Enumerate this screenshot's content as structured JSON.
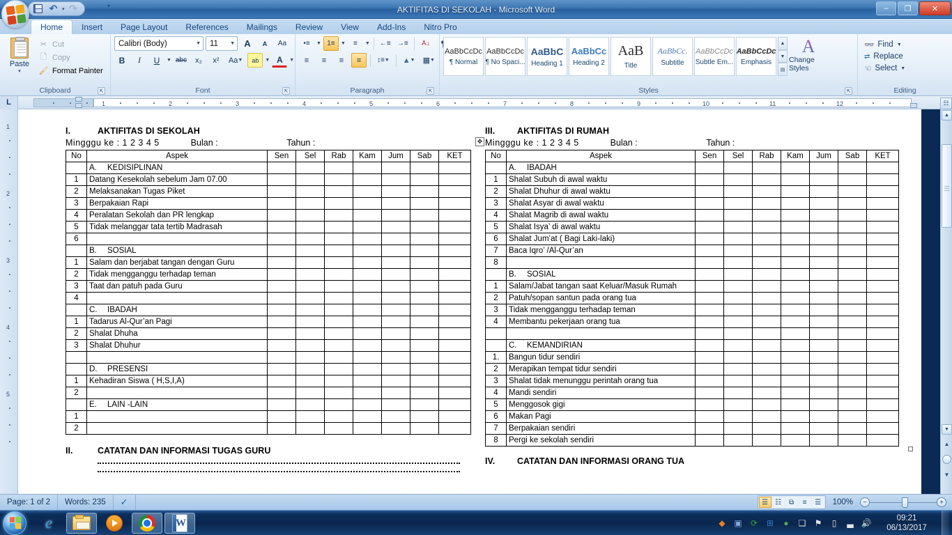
{
  "window": {
    "title": "AKTIFITAS DI SEKOLAH  -  Microsoft Word",
    "minimize_label": "–",
    "maximize_label": "❐",
    "close_label": "✕"
  },
  "quick_access": {
    "save_tooltip": "Save",
    "undo_glyph": "↶",
    "redo_glyph": "↷",
    "dropdown_glyph": "▾"
  },
  "ribbon": {
    "tabs": [
      {
        "label": "Home",
        "active": true
      },
      {
        "label": "Insert",
        "active": false
      },
      {
        "label": "Page Layout",
        "active": false
      },
      {
        "label": "References",
        "active": false
      },
      {
        "label": "Mailings",
        "active": false
      },
      {
        "label": "Review",
        "active": false
      },
      {
        "label": "View",
        "active": false
      },
      {
        "label": "Add-Ins",
        "active": false
      },
      {
        "label": "Nitro Pro",
        "active": false
      }
    ],
    "clipboard": {
      "label": "Clipboard",
      "paste": "Paste",
      "cut": "Cut",
      "copy": "Copy",
      "format_painter": "Format Painter",
      "cut_icon": "scissors-icon",
      "copy_icon": "copy-icon",
      "format_painter_icon": "paintbrush-icon"
    },
    "font": {
      "label": "Font",
      "font_name": "Calibri (Body)",
      "font_size": "11",
      "grow_font": "A",
      "shrink_font": "A",
      "clear_formatting": "Aa",
      "bold": "B",
      "italic": "I",
      "underline": "U",
      "strikethrough": "abc",
      "subscript": "x₂",
      "superscript": "x²",
      "change_case": "Aa",
      "highlight": "ab",
      "font_color": "A"
    },
    "paragraph": {
      "label": "Paragraph",
      "bullets": "•≡",
      "numbering": "1≡",
      "multilevel": "≡",
      "decrease_indent": "←≡",
      "increase_indent": "→≡",
      "sort": "A↓",
      "show_marks": "¶",
      "align_left": "≡",
      "align_center": "≡",
      "align_right": "≡",
      "justify": "≡",
      "line_spacing": "↕≡",
      "shading": "▲",
      "borders": "▦"
    },
    "styles": {
      "label": "Styles",
      "items": [
        {
          "sample": "AaBbCcDc",
          "name": "¶ Normal"
        },
        {
          "sample": "AaBbCcDc",
          "name": "¶ No Spaci..."
        },
        {
          "sample": "AaBbC",
          "name": "Heading 1"
        },
        {
          "sample": "AaBbCc",
          "name": "Heading 2"
        },
        {
          "sample": "AaB",
          "name": "Title"
        },
        {
          "sample": "AaBbCc.",
          "name": "Subtitle"
        },
        {
          "sample": "AaBbCcDc",
          "name": "Subtle Em..."
        },
        {
          "sample": "AaBbCcDc",
          "name": "Emphasis"
        }
      ],
      "change_styles": "Change Styles"
    },
    "editing": {
      "label": "Editing",
      "find": "Find",
      "replace": "Replace",
      "select": "Select",
      "find_icon": "binoculars-icon",
      "replace_icon": "replace-icon",
      "select_icon": "cursor-select-icon"
    }
  },
  "ruler": {
    "tab_selector": "L",
    "h_ticks": [
      "1",
      "2",
      "3",
      "4",
      "5",
      "6",
      "7",
      "8",
      "9",
      "10",
      "11",
      "12"
    ],
    "v_ticks": [
      "1",
      "2",
      "3",
      "4",
      "5"
    ]
  },
  "document": {
    "table_handle_glyph": "✥",
    "columns": [
      "No",
      "Aspek",
      "Sen",
      "Sel",
      "Rab",
      "Kam",
      "Jum",
      "Sab",
      "KET"
    ],
    "left": {
      "section_number": "I.",
      "section_title": "AKTIFITAS DI SEKOLAH",
      "week_label": "Mingggu ke : 1   2  3  4   5",
      "month_label": "Bulan :",
      "year_label": "Tahun :",
      "rows": [
        {
          "no": "",
          "aspek": "KEDISIPLINAN",
          "letter": "A.",
          "group": true
        },
        {
          "no": "1",
          "aspek": "Datang Kesekolah sebelum Jam 07.00",
          "group": false
        },
        {
          "no": "2",
          "aspek": "Melaksanakan Tugas Piket",
          "group": false
        },
        {
          "no": "3",
          "aspek": "Berpakaian Rapi",
          "group": false
        },
        {
          "no": "4",
          "aspek": "Peralatan Sekolah dan PR lengkap",
          "group": false
        },
        {
          "no": "5",
          "aspek": "Tidak melanggar tata tertib Madrasah",
          "group": false
        },
        {
          "no": "6",
          "aspek": "",
          "group": false
        },
        {
          "no": "",
          "aspek": "SOSIAL",
          "letter": "B.",
          "group": true
        },
        {
          "no": "1",
          "aspek": "Salam dan berjabat tangan dengan Guru",
          "group": false
        },
        {
          "no": "2",
          "aspek": "Tidak mengganggu  terhadap teman",
          "group": false
        },
        {
          "no": "3",
          "aspek": "Taat dan patuh pada Guru",
          "group": false
        },
        {
          "no": "4",
          "aspek": "",
          "group": false
        },
        {
          "no": "",
          "aspek": "IBADAH",
          "letter": "C.",
          "group": true
        },
        {
          "no": "1",
          "aspek": "Tadarus Al-Qur’an Pagi",
          "group": false
        },
        {
          "no": "2",
          "aspek": "Shalat Dhuha",
          "group": false
        },
        {
          "no": "3",
          "aspek": "Shalat Dhuhur",
          "group": false
        },
        {
          "no": "",
          "aspek": "",
          "group": false
        },
        {
          "no": "",
          "aspek": "PRESENSI",
          "letter": "D.",
          "group": true
        },
        {
          "no": "1",
          "aspek": "Kehadiran Siswa ( H,S,I,A)",
          "group": false
        },
        {
          "no": "2",
          "aspek": "",
          "group": false
        },
        {
          "no": "",
          "aspek": "LAIN -LAIN",
          "letter": "E.",
          "group": true
        },
        {
          "no": "1",
          "aspek": "",
          "group": false
        },
        {
          "no": "2",
          "aspek": "",
          "group": false
        }
      ],
      "notes_number": "II.",
      "notes_title": "CATATAN DAN INFORMASI TUGAS GURU"
    },
    "right": {
      "section_number": "III.",
      "section_title": "AKTIFITAS DI RUMAH",
      "week_label": "Mingggu ke : 1   2  3  4   5",
      "month_label": "Bulan :",
      "year_label": "Tahun :",
      "rows": [
        {
          "no": "",
          "aspek": "IBADAH",
          "letter": "A.",
          "group": true
        },
        {
          "no": "1",
          "aspek": "Shalat Subuh di awal waktu",
          "group": false
        },
        {
          "no": "2",
          "aspek": "Shalat Dhuhur di awal  waktu",
          "group": false
        },
        {
          "no": "3",
          "aspek": "Shalat Asyar di awal waktu",
          "group": false
        },
        {
          "no": "4",
          "aspek": "Shalat Magrib di awal  waktu",
          "group": false
        },
        {
          "no": "5",
          "aspek": "Shalat Isya’ di awal waktu",
          "group": false
        },
        {
          "no": "6",
          "aspek": "Shalat Jum’at  ( Bagi Laki-laki)",
          "group": false
        },
        {
          "no": "7",
          "aspek": "Baca Iqro’ /Al-Qur’an",
          "group": false
        },
        {
          "no": "8",
          "aspek": "",
          "group": false
        },
        {
          "no": "",
          "aspek": "SOSIAL",
          "letter": "B.",
          "group": true
        },
        {
          "no": "1",
          "aspek": "Salam/Jabat tangan  saat Keluar/Masuk Rumah",
          "group": false
        },
        {
          "no": "2",
          "aspek": "Patuh/sopan santun pada orang tua",
          "group": false
        },
        {
          "no": "3",
          "aspek": "Tidak mengganggu  terhadap teman",
          "group": false
        },
        {
          "no": "4",
          "aspek": "Membantu pekerjaan orang tua",
          "group": false
        },
        {
          "no": "",
          "aspek": "",
          "group": false
        },
        {
          "no": "",
          "aspek": "KEMANDIRIAN",
          "letter": "C.",
          "group": true
        },
        {
          "no": "1.",
          "aspek": "Bangun tidur sendiri",
          "group": false
        },
        {
          "no": "2",
          "aspek": "Merapikan tempat tidur sendiri",
          "group": false
        },
        {
          "no": "3",
          "aspek": "Shalat tidak menunggu perintah orang tua",
          "group": false
        },
        {
          "no": "4",
          "aspek": "Mandi sendiri",
          "group": false
        },
        {
          "no": "5",
          "aspek": "Menggosok gigi",
          "group": false
        },
        {
          "no": "6",
          "aspek": "Makan  Pagi",
          "group": false
        },
        {
          "no": "7",
          "aspek": "Berpakaian sendiri",
          "group": false
        },
        {
          "no": "8",
          "aspek": "Pergi ke sekolah sendiri",
          "group": false
        }
      ],
      "notes_number": "IV.",
      "notes_title": "CATATAN DAN INFORMASI ORANG TUA"
    }
  },
  "status_bar": {
    "page": "Page: 1 of 2",
    "words": "Words: 235",
    "proofing_icon": "proofing-check-icon",
    "views": [
      {
        "name": "print-layout",
        "glyph": "☰",
        "active": true
      },
      {
        "name": "full-screen-reading",
        "glyph": "☷",
        "active": false
      },
      {
        "name": "web-layout",
        "glyph": "⧉",
        "active": false
      },
      {
        "name": "outline",
        "glyph": "≡",
        "active": false
      },
      {
        "name": "draft",
        "glyph": "☰",
        "active": false
      }
    ],
    "zoom": "100%",
    "zoom_out": "−",
    "zoom_in": "+"
  },
  "taskbar": {
    "start_tooltip": "Start",
    "items": [
      {
        "name": "internet-explorer",
        "pinned": false
      },
      {
        "name": "windows-explorer",
        "pinned": true
      },
      {
        "name": "windows-media-player",
        "pinned": false
      },
      {
        "name": "google-chrome",
        "pinned": true
      },
      {
        "name": "microsoft-word",
        "pinned": true
      }
    ],
    "tray": [
      {
        "name": "avast-icon",
        "glyph": "◆",
        "color": "#f07c21"
      },
      {
        "name": "network-tool-icon",
        "glyph": "▣",
        "color": "#7ea8d8"
      },
      {
        "name": "sync-icon",
        "glyph": "⟳",
        "color": "#36a832"
      },
      {
        "name": "excel-tray-icon",
        "glyph": "⊞",
        "color": "#2f7bc4"
      },
      {
        "name": "idm-icon",
        "glyph": "●",
        "color": "#4fa84f"
      },
      {
        "name": "printer-icon",
        "glyph": "❑",
        "color": "#cccccc"
      },
      {
        "name": "flag-action-center-icon",
        "glyph": "⚑",
        "color": "#e6e6e6"
      },
      {
        "name": "battery-icon",
        "glyph": "▯",
        "color": "#e6e6e6"
      },
      {
        "name": "network-signal-icon",
        "glyph": "▃",
        "color": "#e6e6e6"
      },
      {
        "name": "volume-icon",
        "glyph": "🔊",
        "color": "#e6e6e6"
      }
    ],
    "clock_time": "09:21",
    "clock_date": "06/13/2017"
  }
}
